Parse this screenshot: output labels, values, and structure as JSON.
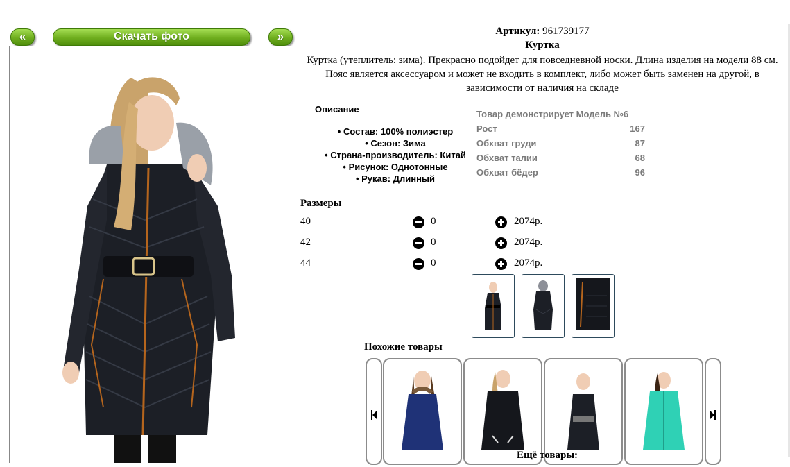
{
  "nav": {
    "prev_label": "«",
    "download_label": "Скачать фото",
    "next_label": "»"
  },
  "product": {
    "article_label": "Артикул:",
    "article_value": "961739177",
    "name": "Куртка",
    "description": "Куртка (утеплитель: зима). Прекрасно подойдет для повседневной носки. Длина изделия на модели 88 см. Пояс является аксессуаром и может не входить в комплект, либо может быть заменен на другой, в зависимости от наличия на складе",
    "details_title": "Описание",
    "details": [
      "Состав: 100% полиэстер",
      "Сезон: Зима",
      "Страна-производитель: Китай",
      "Рисунок: Однотонные",
      "Рукав: Длинный"
    ]
  },
  "model_info": {
    "title": "Товар демонстрирует Модель №6",
    "rows": [
      {
        "label": "Рост",
        "value": "167"
      },
      {
        "label": "Обхват груди",
        "value": "87"
      },
      {
        "label": "Обхват талии",
        "value": "68"
      },
      {
        "label": "Обхват бёдер",
        "value": "96"
      }
    ]
  },
  "sizes": {
    "title": "Размеры",
    "rows": [
      {
        "size": "40",
        "qty": "0",
        "price": "2074р."
      },
      {
        "size": "42",
        "qty": "0",
        "price": "2074р."
      },
      {
        "size": "44",
        "qty": "0",
        "price": "2074р."
      }
    ]
  },
  "similar": {
    "title": "Похожие товары",
    "more_label": "Ещё товары:"
  },
  "colors": {
    "jacket": "#1c1f26",
    "zipper": "#b5651d",
    "fur": "#9aa0a8",
    "hair": "#c9a36b",
    "navy": "#1f3277",
    "mint": "#2fd1b5",
    "green_button": "#6fae1e"
  }
}
